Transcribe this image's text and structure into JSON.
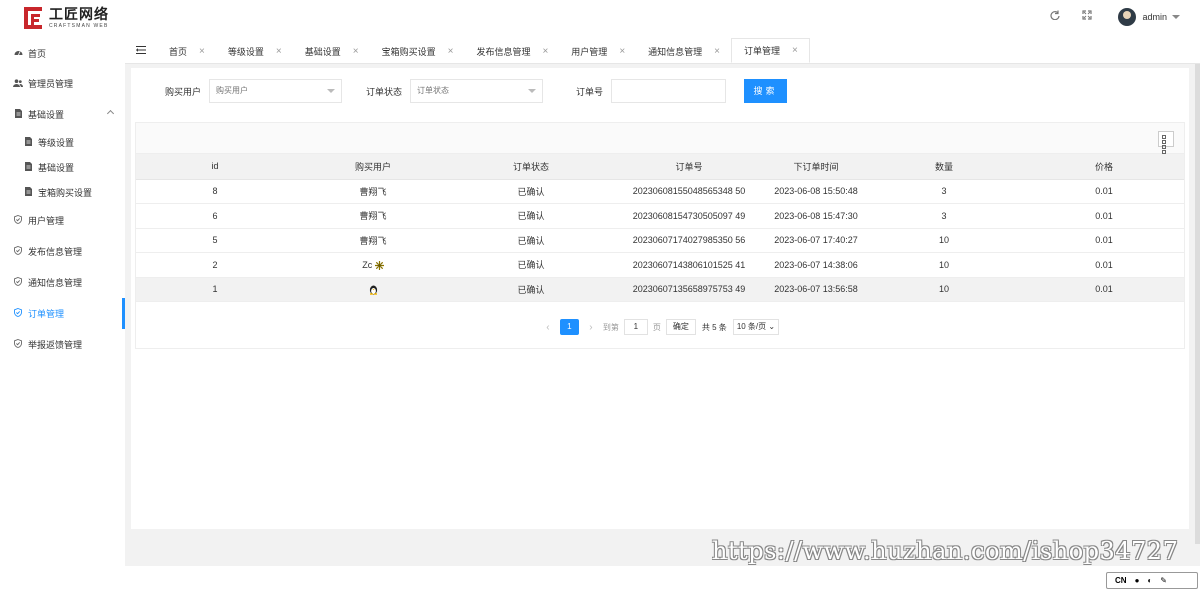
{
  "brand": {
    "title": "工匠网络",
    "subtitle": "CRAFTSMAN WEB",
    "accent": "#c8262b"
  },
  "header": {
    "refresh_icon": "refresh-icon",
    "fullscreen_icon": "fullscreen-icon",
    "user": "admin"
  },
  "sidebar": {
    "items": [
      {
        "label": "首页",
        "icon": "dashboard-icon"
      },
      {
        "label": "管理员管理",
        "icon": "users-icon"
      },
      {
        "label": "基础设置",
        "icon": "file-icon",
        "expanded": true
      },
      {
        "label": "等级设置",
        "icon": "file-icon",
        "sub": true
      },
      {
        "label": "基础设置",
        "icon": "file-icon",
        "sub": true
      },
      {
        "label": "宝箱购买设置",
        "icon": "file-icon",
        "sub": true
      },
      {
        "label": "用户管理",
        "icon": "shield-icon"
      },
      {
        "label": "发布信息管理",
        "icon": "shield-icon"
      },
      {
        "label": "通知信息管理",
        "icon": "shield-icon"
      },
      {
        "label": "订单管理",
        "icon": "shield-icon",
        "active": true
      },
      {
        "label": "举报返馈管理",
        "icon": "shield-icon"
      }
    ]
  },
  "tabs": [
    {
      "label": "首页"
    },
    {
      "label": "等级设置"
    },
    {
      "label": "基础设置"
    },
    {
      "label": "宝箱购买设置"
    },
    {
      "label": "发布信息管理"
    },
    {
      "label": "用户管理"
    },
    {
      "label": "通知信息管理"
    },
    {
      "label": "订单管理",
      "active": true
    }
  ],
  "filters": {
    "buyer_label": "购买用户",
    "buyer_placeholder": "购买用户",
    "status_label": "订单状态",
    "status_placeholder": "订单状态",
    "order_no_label": "订单号",
    "order_no_value": "",
    "search_label": "搜索"
  },
  "table": {
    "columns": [
      "id",
      "购买用户",
      "订单状态",
      "订单号",
      "下订单时间",
      "数量",
      "价格"
    ],
    "rows": [
      [
        "8",
        "曹翔飞",
        "已确认",
        "20230608155048565348 50",
        "2023-06-08 15:50:48",
        "3",
        "0.01"
      ],
      [
        "6",
        "曹翔飞",
        "已确认",
        "20230608154730505097 49",
        "2023-06-08 15:47:30",
        "3",
        "0.01"
      ],
      [
        "5",
        "曹翔飞",
        "已确认",
        "20230607174027985350 56",
        "2023-06-07 17:40:27",
        "10",
        "0.01"
      ],
      [
        "2",
        "Zc",
        "已确认",
        "20230607143806101525 41",
        "2023-06-07 14:38:06",
        "10",
        "0.01"
      ],
      [
        "1",
        "",
        "已确认",
        "20230607135658975753 49",
        "2023-06-07 13:56:58",
        "10",
        "0.01"
      ]
    ]
  },
  "pager": {
    "current": "1",
    "goto_label": "到第",
    "goto_value": "1",
    "page_unit": "页",
    "confirm_label": "确定",
    "total_label": "共 5 条",
    "page_size": "10 条/页"
  },
  "watermark": "https://www.huzhan.com/ishop34727",
  "ime": {
    "lang": "CN"
  }
}
